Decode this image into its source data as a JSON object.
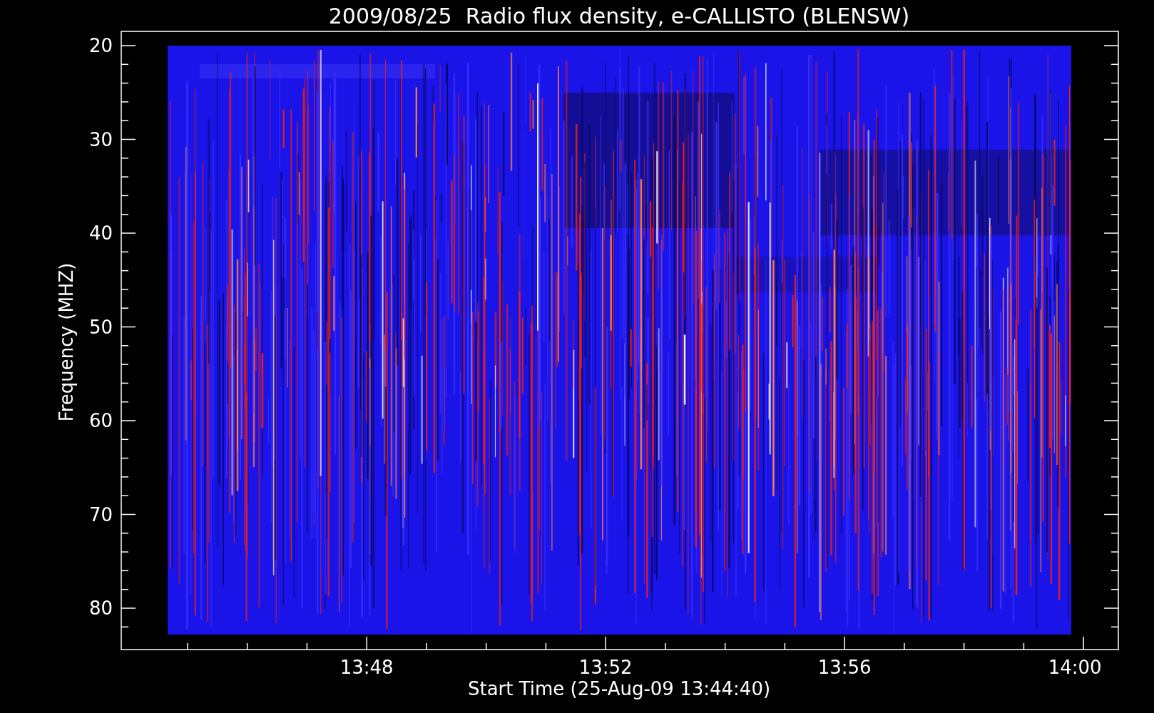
{
  "chart": {
    "title": "2009/08/25  Radio flux density, e-CALLISTO (BLENSW)",
    "xlabel": "Start Time (25-Aug-09 13:44:40)",
    "ylabel": "Frequency (MHZ)",
    "yticks": [
      "20",
      "30",
      "40",
      "50",
      "60",
      "70",
      "80"
    ],
    "xticks": [
      "13:48",
      "13:52",
      "13:56",
      "14:00"
    ]
  }
}
